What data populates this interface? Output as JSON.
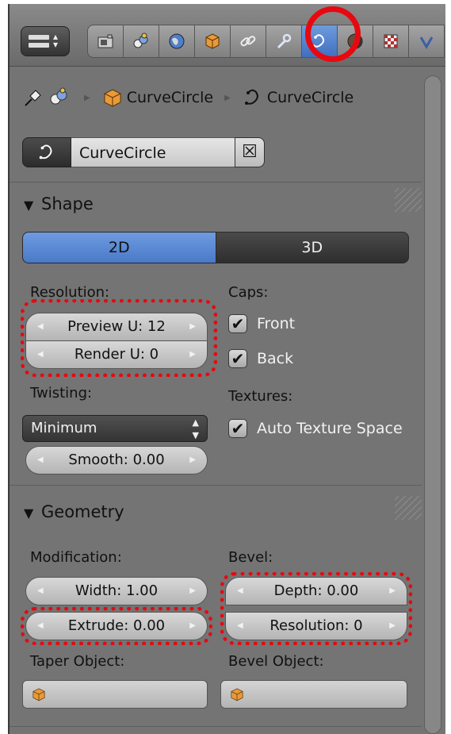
{
  "tabs": [
    {
      "icon": "render-tab-icon",
      "active": false
    },
    {
      "icon": "render-layers-tab-icon",
      "active": false
    },
    {
      "icon": "world-tab-icon",
      "active": false
    },
    {
      "icon": "object-tab-icon",
      "active": false
    },
    {
      "icon": "constraints-tab-icon",
      "active": false
    },
    {
      "icon": "modifiers-tab-icon",
      "active": false
    },
    {
      "icon": "curve-data-tab-icon",
      "active": true
    },
    {
      "icon": "material-tab-icon",
      "active": false
    },
    {
      "icon": "texture-tab-icon",
      "active": false
    },
    {
      "icon": "physics-tab-icon",
      "active": false
    }
  ],
  "breadcrumb": {
    "object_name": "CurveCircle",
    "data_name": "CurveCircle"
  },
  "datablock": {
    "name": "CurveCircle",
    "close_glyph": "☒"
  },
  "shape": {
    "title": "Shape",
    "mode_2d": "2D",
    "mode_3d": "3D",
    "resolution_label": "Resolution:",
    "preview_u": "Preview U: 12",
    "render_u": "Render U: 0",
    "caps_label": "Caps:",
    "front_label": "Front",
    "back_label": "Back",
    "twisting_label": "Twisting:",
    "twisting_value": "Minimum",
    "smooth": "Smooth: 0.00",
    "textures_label": "Textures:",
    "auto_texture_space": "Auto Texture Space"
  },
  "geometry": {
    "title": "Geometry",
    "modification_label": "Modification:",
    "width": "Width: 1.00",
    "extrude": "Extrude: 0.00",
    "bevel_label": "Bevel:",
    "depth": "Depth: 0.00",
    "resolution": "Resolution: 0",
    "taper_object_label": "Taper Object:",
    "bevel_object_label": "Bevel Object:"
  },
  "colors": {
    "accent_blue": "#4a79c8",
    "highlight_red": "#e8080f",
    "panel_bg": "#747474"
  }
}
